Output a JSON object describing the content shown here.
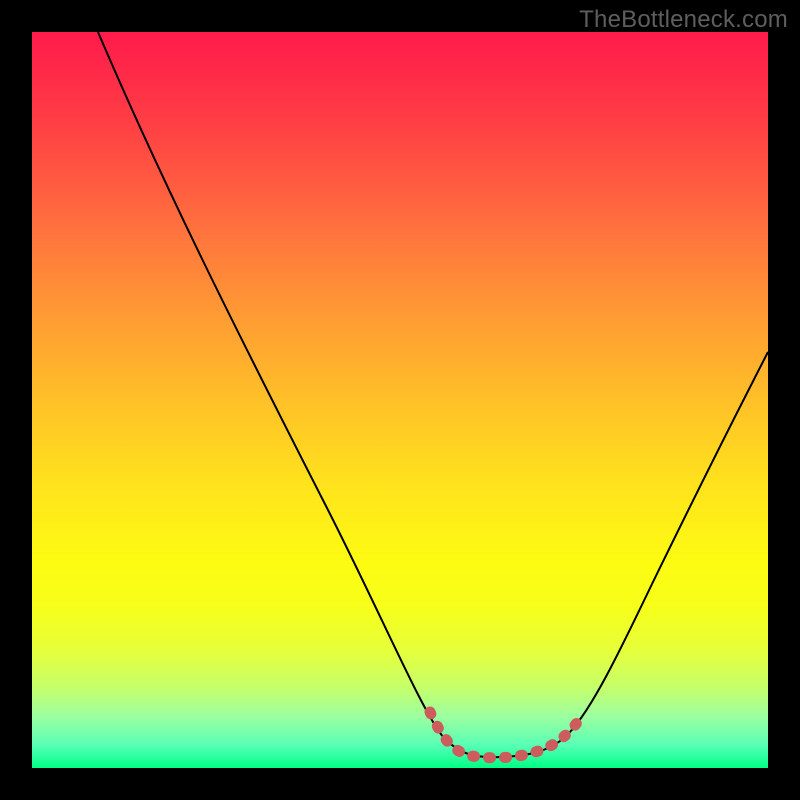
{
  "watermark": "TheBottleneck.com",
  "chart_data": {
    "type": "line",
    "title": "",
    "xlabel": "",
    "ylabel": "",
    "xlim": [
      0,
      100
    ],
    "ylim": [
      0,
      100
    ],
    "grid": false,
    "series": [
      {
        "name": "black-curve",
        "x": [
          9,
          24,
          40,
          55,
          58,
          62,
          70,
          74,
          80,
          90,
          100
        ],
        "y": [
          100,
          73,
          44,
          14,
          6,
          2,
          2,
          6,
          20,
          42,
          62
        ],
        "color": "#000000",
        "stroke_width": 2
      },
      {
        "name": "highlight-segment",
        "x": [
          55,
          58,
          62,
          70,
          74
        ],
        "y": [
          14,
          6,
          2,
          2,
          6
        ],
        "color": "#cd5c5c",
        "stroke_width": 10,
        "dash": "2,14"
      }
    ],
    "legend": false
  },
  "colors": {
    "background_frame": "#000000",
    "gradient_top": "#ff1b4b",
    "gradient_bottom": "#00ff85",
    "curve": "#000000",
    "highlight": "#cd5c5c",
    "watermark": "#5e5e5e"
  }
}
